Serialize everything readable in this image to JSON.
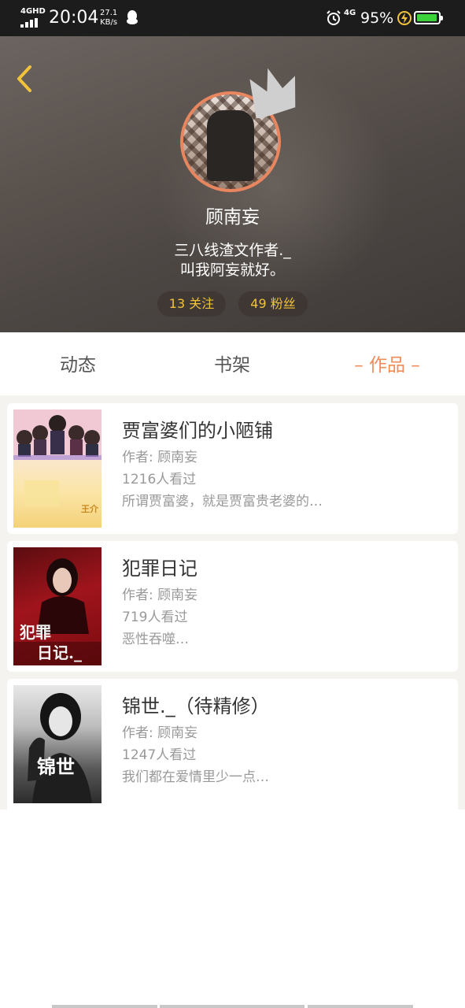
{
  "status_bar": {
    "network": "4GHD",
    "time": "20:04",
    "speed_value": "27.1",
    "speed_unit": "KB/s",
    "network2": "4G",
    "battery_percent": "95%",
    "battery_level": 0.95,
    "battery_color": "#3ad33a",
    "icons": [
      "signal-icon",
      "qq-icon",
      "alarm-icon",
      "charging-bolt-icon",
      "battery-icon"
    ]
  },
  "profile": {
    "name": "顾南妄",
    "bio_line1": "三八线渣文作者._",
    "bio_line2": "叫我阿妄就好。",
    "follow_label": "13 关注",
    "fans_label": "49 粉丝",
    "accent_color": "#ef8c58"
  },
  "tabs": [
    {
      "label": "动态",
      "active": false
    },
    {
      "label": "书架",
      "active": false
    },
    {
      "label": "– 作品 –",
      "active": true
    }
  ],
  "works": [
    {
      "title": "贾富婆们的小陋铺",
      "author": "作者: 顾南妄",
      "views": "1216人看过",
      "desc": "所谓贾富婆，就是贾富贵老婆的…",
      "cover_text": "王介"
    },
    {
      "title": "犯罪日记",
      "author": "作者: 顾南妄",
      "views": "719人看过",
      "desc": "恶性吞噬…",
      "cover_text_1": "犯罪",
      "cover_text_2": "日记._"
    },
    {
      "title": "锦世._（待精修）",
      "author": "作者: 顾南妄",
      "views": "1247人看过",
      "desc": "我们都在爱情里少一点…",
      "cover_text": "锦世"
    }
  ]
}
